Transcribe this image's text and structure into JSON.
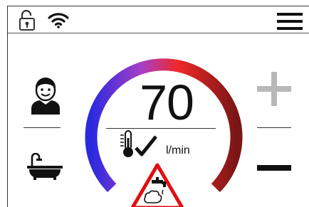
{
  "status_bar": {
    "lock_icon": "unlocked-padlock-icon",
    "wifi_icon": "wifi-icon",
    "menu_icon": "hamburger-menu-icon"
  },
  "left_panel": {
    "user_icon": "child-user-icon",
    "mode_icon": "bathtub-icon"
  },
  "gauge": {
    "value": "70",
    "unit": "l/min",
    "temperature_icon": "thermometer-check-icon",
    "warning_icon": "warning-faucet-triangle-icon",
    "arc_colors": [
      "#2222dd",
      "#b03ac0",
      "#ee2222",
      "#8a1a1a"
    ]
  },
  "right_panel": {
    "plus_icon": "plus-icon",
    "minus_icon": "minus-icon",
    "plus_color": "#b8b8b8",
    "minus_color": "#111111"
  }
}
